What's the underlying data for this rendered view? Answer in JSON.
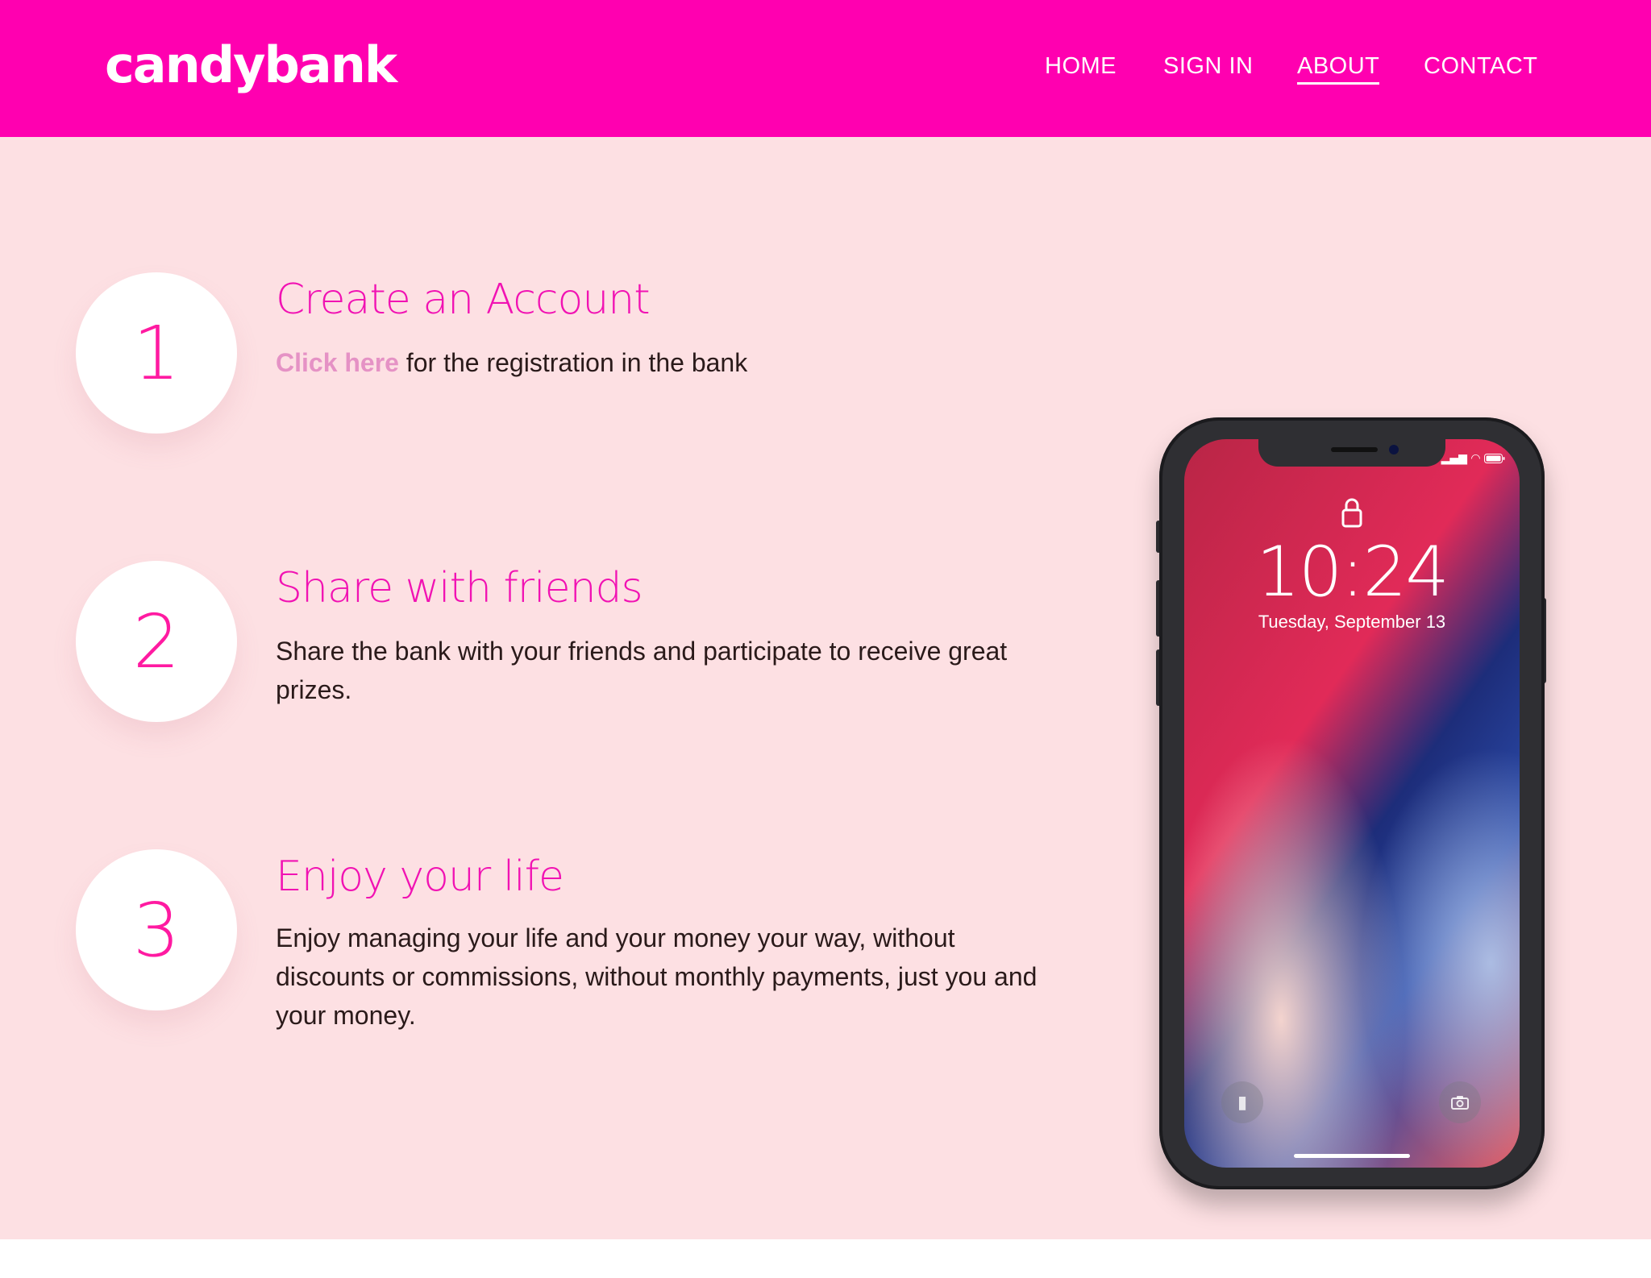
{
  "header": {
    "logo": "candybank",
    "nav": [
      {
        "label": "HOME",
        "active": false
      },
      {
        "label": "SIGN IN",
        "active": false
      },
      {
        "label": "ABOUT",
        "active": true
      },
      {
        "label": "CONTACT",
        "active": false
      }
    ]
  },
  "steps": [
    {
      "number": "1",
      "title": "Create an Account",
      "link": "Click here",
      "text": " for the registration in the bank"
    },
    {
      "number": "2",
      "title": "Share with friends",
      "text": "Share the bank with your friends and participate to receive great prizes."
    },
    {
      "number": "3",
      "title": "Enjoy your life",
      "text": "Enjoy managing your life and your money your way, without discounts or commissions, without monthly payments, just you and your money."
    }
  ],
  "phone": {
    "time": "10:24",
    "date": "Tuesday, September 13",
    "icons": [
      "lock-icon",
      "signal-icon",
      "wifi-icon",
      "battery-icon",
      "flashlight-icon",
      "camera-icon"
    ]
  },
  "colors": {
    "header_bg": "#ff00b0",
    "main_bg": "#fde0e3",
    "accent": "#f112b3",
    "link": "#e592c5"
  }
}
